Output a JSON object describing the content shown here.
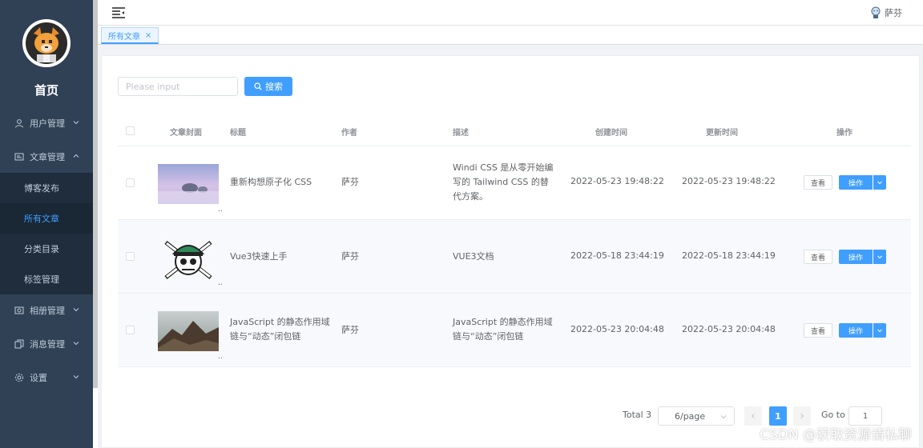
{
  "brand": "首页",
  "header": {
    "user_name": "萨芬"
  },
  "tags": [
    {
      "label": "所有文章",
      "close": "×"
    }
  ],
  "sidebar": {
    "items": [
      {
        "label": "用户管理"
      },
      {
        "label": "文章管理"
      },
      {
        "label": "相册管理"
      },
      {
        "label": "消息管理"
      },
      {
        "label": "设置"
      }
    ],
    "sub_items": [
      {
        "label": "博客发布"
      },
      {
        "label": "所有文章"
      },
      {
        "label": "分类目录"
      },
      {
        "label": "标签管理"
      }
    ]
  },
  "search": {
    "placeholder": "Please input",
    "button_label": "搜索"
  },
  "table": {
    "headers": [
      "文章封面",
      "标题",
      "作者",
      "描述",
      "创建时间",
      "更新时间",
      "操作"
    ],
    "rows": [
      {
        "title": "重新构想原子化 CSS",
        "author": "萨芬",
        "description": "Windi CSS 是从零开始编写的 Tailwind CSS 的替代方案。",
        "created": "2022-05-23 19:48:22",
        "updated": "2022-05-23 19:48:22",
        "view_label": "查看",
        "op_label": "操作",
        "dots": ".."
      },
      {
        "title": "Vue3快速上手",
        "author": "萨芬",
        "description": "VUE3文档",
        "created": "2022-05-18 23:44:19",
        "updated": "2022-05-18 23:44:19",
        "view_label": "查看",
        "op_label": "操作",
        "dots": ".."
      },
      {
        "title": "JavaScript 的静态作用域链与“动态”闭包链",
        "author": "萨芬",
        "description": "JavaScript 的静态作用域链与“动态”闭包链",
        "created": "2022-05-23 20:04:48",
        "updated": "2022-05-23 20:04:48",
        "view_label": "查看",
        "op_label": "操作",
        "dots": ".."
      }
    ]
  },
  "pagination": {
    "total": "Total 3",
    "page_size": "6/page",
    "current_page": "1",
    "goto_label": "Go to",
    "goto_value": "1"
  },
  "watermark": "CSDN @获取资源请私聊",
  "colors": {
    "primary": "#409eff",
    "sidebar_bg": "#304156",
    "sidebar_text": "#bfcbd9"
  }
}
